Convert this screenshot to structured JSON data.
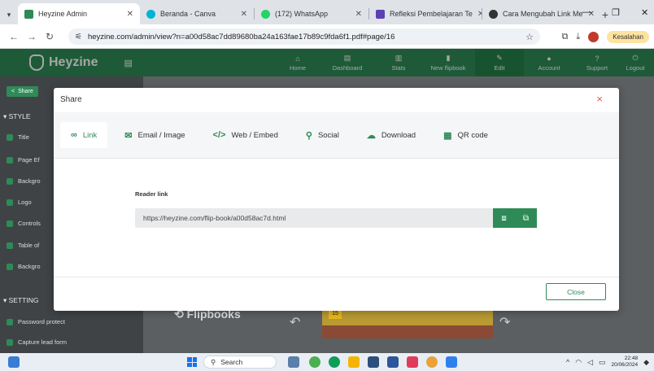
{
  "browser": {
    "tabs": [
      {
        "title": "Heyzine Admin",
        "favicon_color": "#2e8b57",
        "active": true
      },
      {
        "title": "Beranda - Canva",
        "favicon_color": "#00b3d7",
        "active": false
      },
      {
        "title": "(172) WhatsApp",
        "favicon_color": "#25d366",
        "active": false
      },
      {
        "title": "Refleksi Pembelajaran Te",
        "favicon_color": "#5b3fb3",
        "active": false
      },
      {
        "title": "Cara Mengubah Link Me",
        "favicon_color": "#333333",
        "active": false
      }
    ],
    "url": "heyzine.com/admin/view?n=a00d58ac7dd89680ba24a163fae17b89c9fda6f1.pdf#page/16",
    "error_badge": "Kesalahan"
  },
  "app": {
    "brand": "Heyzine",
    "nav": [
      {
        "label": "Home",
        "icon": "home-icon",
        "glyph": "⌂"
      },
      {
        "label": "Dashboard",
        "icon": "dashboard-icon",
        "glyph": "▤"
      },
      {
        "label": "Stats",
        "icon": "stats-icon",
        "glyph": "▥"
      },
      {
        "label": "New flipbook",
        "icon": "new-file-icon",
        "glyph": "▮"
      },
      {
        "label": "Edit",
        "icon": "pencil-icon",
        "glyph": "✎"
      },
      {
        "label": "Account",
        "icon": "user-icon",
        "glyph": "●"
      },
      {
        "label": "Support",
        "icon": "question-icon",
        "glyph": "?"
      },
      {
        "label": "Logout",
        "icon": "power-icon",
        "glyph": "⏻"
      }
    ],
    "sidebar": {
      "share_button": "Share",
      "section_style": "▾ STYLE",
      "items": [
        "Title",
        "Page Ef",
        "Backgro",
        "Logo",
        "Controls",
        "Table of",
        "Backgro"
      ],
      "section_settings": "▾ SETTING",
      "settings_items": [
        "Password protect",
        "Capture lead form"
      ]
    },
    "background": {
      "flipbook_brand": "Flipbooks",
      "page_badge": "15"
    },
    "accent_color": "#2e8b57"
  },
  "modal": {
    "title": "Share",
    "close_glyph": "×",
    "tabs": [
      {
        "label": "Link",
        "icon": "link-icon",
        "glyph": "∞"
      },
      {
        "label": "Email / Image",
        "icon": "email-icon",
        "glyph": "✉"
      },
      {
        "label": "Web / Embed",
        "icon": "code-icon",
        "glyph": "</>"
      },
      {
        "label": "Social",
        "icon": "person-icon",
        "glyph": "⚲"
      },
      {
        "label": "Download",
        "icon": "cloud-download-icon",
        "glyph": "☁"
      },
      {
        "label": "QR code",
        "icon": "qr-code-icon",
        "glyph": "▦"
      }
    ],
    "active_tab": "Link",
    "reader_link_label": "Reader link",
    "reader_link_value": "https://heyzine.com/flip-book/a00d58ac7d.html",
    "close_button": "Close"
  },
  "taskbar": {
    "search_placeholder": "Search",
    "time": "22:48",
    "date": "20/06/2024"
  }
}
